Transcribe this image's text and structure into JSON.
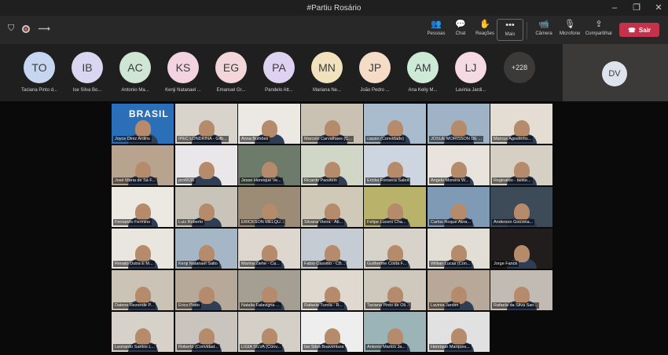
{
  "window": {
    "title": "#Partiu Rosário"
  },
  "toolbar": {
    "people_label": "Pessoas",
    "chat_label": "Chat",
    "reactions_label": "Reações",
    "more_label": "Mais",
    "camera_label": "Câmera",
    "mic_label": "Microfone",
    "share_label": "Compartilhar",
    "leave_label": "Sair"
  },
  "participants_strip": [
    {
      "initials": "TO",
      "name": "Taciana Pinto d...",
      "color": "#c7d6f0"
    },
    {
      "initials": "IB",
      "name": "Ise Silva Bo...",
      "color": "#d9d6f2"
    },
    {
      "initials": "AC",
      "name": "Antonio Ma...",
      "color": "#cfe6d4"
    },
    {
      "initials": "KS",
      "name": "Kenji Natanael ...",
      "color": "#f3d3e0"
    },
    {
      "initials": "EG",
      "name": "Emanuel Gr...",
      "color": "#f3d6d9"
    },
    {
      "initials": "PA",
      "name": "Pandelo Att...",
      "color": "#ddd2f0"
    },
    {
      "initials": "MN",
      "name": "Mariana Ne...",
      "color": "#f1e2bd"
    },
    {
      "initials": "JP",
      "name": "João Pedro ...",
      "color": "#f5dcc6"
    },
    {
      "initials": "AM",
      "name": "Ana Kelly M...",
      "color": "#cdead6"
    },
    {
      "initials": "LJ",
      "name": "Lavinia Jardi...",
      "color": "#f5d9e3"
    }
  ],
  "overflow_count": "+228",
  "self_tile": {
    "initials": "DV"
  },
  "video_tiles": [
    {
      "name": "Joyce Diniz Ardins",
      "bg": "#2a6fb8",
      "logo": "BRASIL"
    },
    {
      "name": "IPEC LONDRINA - Gilb...",
      "bg": "#d8d4cc"
    },
    {
      "name": "Anna Bulhões",
      "bg": "#ece9e4"
    },
    {
      "name": "Marcelo Carvalhaes (C...",
      "bg": "#c9c2b3"
    },
    {
      "name": "cassio (Convidado)",
      "bg": "#a8bccd"
    },
    {
      "name": "JOSUE MORISSON DE ...",
      "bg": "#9fb2c6"
    },
    {
      "name": "Marcus Agostinho...",
      "bg": "#e3ddd3"
    },
    {
      "name": "José Maria de Sá F...",
      "bg": "#b8a48e"
    },
    {
      "name": "pro6536",
      "bg": "#e9e7ea"
    },
    {
      "name": "Jesse Henrique Ve...",
      "bg": "#6d7b6a"
    },
    {
      "name": "Ricardo Paostein",
      "bg": "#d1d7c7"
    },
    {
      "name": "Ericka Fonseca Sales",
      "bg": "#cdd6e0"
    },
    {
      "name": "Angelo Moreira W...",
      "bg": "#e8e4dd"
    },
    {
      "name": "Reginaldo - tanke...",
      "bg": "#d6cfc4"
    },
    {
      "name": "Fernando Fermino",
      "bg": "#ece8e2"
    },
    {
      "name": "Luiz Roberto",
      "bg": "#c8c4b9"
    },
    {
      "name": "ERICKSON MELQU...",
      "bg": "#9c8c76"
    },
    {
      "name": "Silvana Vieira - Atl...",
      "bg": "#d0c9b8"
    },
    {
      "name": "Felipe Lucero Cha...",
      "bg": "#b9b26a"
    },
    {
      "name": "Carlos Roque Abra...",
      "bg": "#7f9ab5"
    },
    {
      "name": "Anderson Gouveia...",
      "bg": "#3d4a57"
    },
    {
      "name": "Renato Dutra E M...",
      "bg": "#e9e5df"
    },
    {
      "name": "Kenji Natanael Salto",
      "bg": "#a5b6c7"
    },
    {
      "name": "Marina Ziehe - Ca...",
      "bg": "#ddd7cf"
    },
    {
      "name": "Fabio Cassitto - CB...",
      "bg": "#c5ccd3"
    },
    {
      "name": "Guilherme Costa F...",
      "bg": "#d7d2ca"
    },
    {
      "name": "Willian Lucas (Con...",
      "bg": "#e2ddd5"
    },
    {
      "name": "Jorge Fanck",
      "bg": "#201d1c"
    },
    {
      "name": "Daiene Rezende P...",
      "bg": "#cbc3b6"
    },
    {
      "name": "Erico Patto",
      "bg": "#b7a999"
    },
    {
      "name": "Natalia Falavigna ...",
      "bg": "#a49e93"
    },
    {
      "name": "Rafaela Turola - R...",
      "bg": "#dfd9cf"
    },
    {
      "name": "Taciana Pinto de Oli...",
      "bg": "#cfc8bd"
    },
    {
      "name": "Lavinia Jardim",
      "bg": "#b8a89a"
    },
    {
      "name": "Rafaela da Silva San...",
      "bg": "#c1bbb4"
    },
    {
      "name": "Leonardo Santos L...",
      "bg": "#d6d1c9"
    },
    {
      "name": "Roberto (Convidad...",
      "bg": "#c9c5be"
    },
    {
      "name": "LIGIA SILVA (Conv...",
      "bg": "#d4d0c8"
    },
    {
      "name": "Ise Silva Boaventura",
      "bg": "#eeeeee"
    },
    {
      "name": "Antonio Martos Ja...",
      "bg": "#9bb4b7"
    },
    {
      "name": "Henrique Marques...",
      "bg": "#e1e1e1"
    }
  ]
}
